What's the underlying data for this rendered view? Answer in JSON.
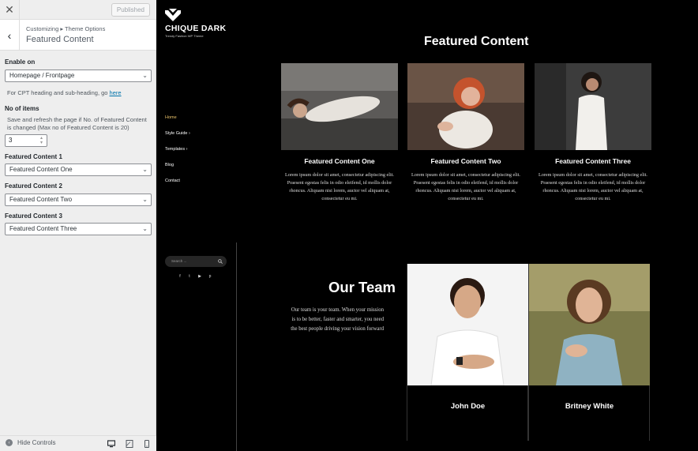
{
  "customizer": {
    "close_glyph": "✕",
    "published_label": "Published",
    "back_glyph": "‹",
    "breadcrumb": "Customizing ▸ Theme Options",
    "section_title": "Featured Content",
    "enable_on": {
      "label": "Enable on",
      "value": "Homepage / Frontpage"
    },
    "cpt_note": {
      "text": "For CPT heading and sub-heading, go ",
      "link": "here"
    },
    "no_of_items": {
      "label": "No of items",
      "description": "Save and refresh the page if No. of Featured Content is changed (Max no of Featured Content is 20)",
      "value": "3"
    },
    "fc1": {
      "label": "Featured Content 1",
      "value": "Featured Content One"
    },
    "fc2": {
      "label": "Featured Content 2",
      "value": "Featured Content Two"
    },
    "fc3": {
      "label": "Featured Content 3",
      "value": "Featured Content Three"
    },
    "hide_controls": "Hide Controls"
  },
  "site": {
    "logo_text": "CHIQUE DARK",
    "tagline": "Trendy Fashion WP Theme",
    "nav": [
      "Home",
      "Style Guide",
      "Templates",
      "Blog",
      "Contact"
    ],
    "nav_arrow": "›",
    "search_placeholder": "Search ...",
    "social_icons": [
      "facebook-icon",
      "twitter-icon",
      "youtube-icon",
      "pinterest-icon"
    ],
    "social_glyphs": [
      "f",
      "t",
      "▶",
      "p"
    ],
    "featured": {
      "title": "Featured Content",
      "items": [
        {
          "name": "Featured Content One",
          "text": "Lorem ipsum dolor sit amet, consectetur adipiscing elit. Praesent egestas felis in odio eleifend, id mollis dolor rhoncus. Aliquam nisi lorem, auctor vel aliquam at, consectetur eu mi."
        },
        {
          "name": "Featured Content Two",
          "text": "Lorem ipsum dolor sit amet, consectetur adipiscing elit. Praesent egestas felis in odio eleifend, id mollis dolor rhoncus. Aliquam nisi lorem, auctor vel aliquam at, consectetur eu mi."
        },
        {
          "name": "Featured Content Three",
          "text": "Lorem ipsum dolor sit amet, consectetur adipiscing elit. Praesent egestas felis in odio eleifend, id mollis dolor rhoncus. Aliquam nisi lorem, auctor vel aliquam at, consectetur eu mi."
        }
      ]
    },
    "team": {
      "title": "Our Team",
      "description": "Our team is your team. When your mission is to be better, faster and smarter, you need the best people driving your vision forward",
      "members": [
        "John Doe",
        "Britney White"
      ]
    }
  },
  "colors": {
    "nav_active": "#e8c16a",
    "link": "#0073aa",
    "preview_bg": "#000000",
    "panel_bg": "#eeeeee"
  }
}
